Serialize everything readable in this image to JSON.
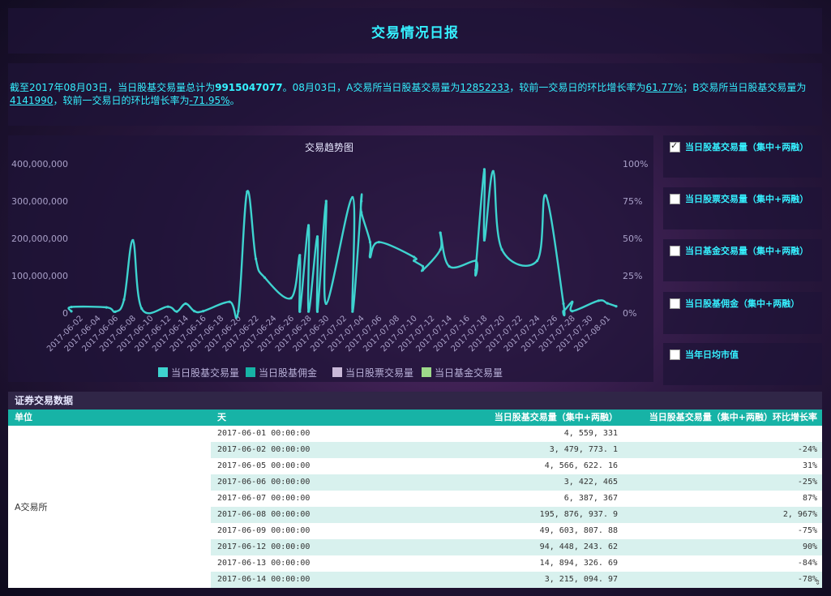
{
  "header": {
    "title": "交易情况日报"
  },
  "summary": {
    "p1": "截至2017年08月03日，当日股基交易量总计为",
    "total": "9915047077",
    "p2": "。08月03日，A交易所当日股基交易量为",
    "a_volume": "12852233",
    "p3": "，较前一交易日的环比增长率为",
    "a_rate": "61.77%",
    "p4": "；B交易所当日股基交易量为",
    "b_volume": "4141990",
    "p5": "，较前一交易日的环比增长率为",
    "b_rate": "-71.95%",
    "p6": "。"
  },
  "chart_data": {
    "type": "line",
    "title": "交易趋势图",
    "ylim": [
      0,
      400000000
    ],
    "y_ticks": [
      "0",
      "100,000,000",
      "200,000,000",
      "300,000,000",
      "400,000,000"
    ],
    "y2lim": [
      0,
      100
    ],
    "y2_ticks": [
      "0%",
      "25%",
      "50%",
      "75%",
      "100%"
    ],
    "x_ticks": [
      "2017-06-02",
      "2017-06-04",
      "2017-06-06",
      "2017-06-08",
      "2017-06-10",
      "2017-06-12",
      "2017-06-14",
      "2017-06-16",
      "2017-06-18",
      "2017-06-20",
      "2017-06-22",
      "2017-06-24",
      "2017-06-26",
      "2017-06-28",
      "2017-06-30",
      "2017-07-02",
      "2017-07-04",
      "2017-07-06",
      "2017-07-08",
      "2017-07-10",
      "2017-07-12",
      "2017-07-14",
      "2017-07-16",
      "2017-07-18",
      "2017-07-20",
      "2017-07-22",
      "2017-07-24",
      "2017-07-26",
      "2017-07-28",
      "2017-07-30",
      "2017-08-01"
    ],
    "grid": false,
    "legend_position": "bottom",
    "series": [
      {
        "name": "当日股基交易量",
        "color": "#3ed3cf",
        "visible": true,
        "x": [
          "2017-06-01",
          "2017-06-01",
          "2017-06-05",
          "2017-06-06",
          "2017-06-07",
          "2017-06-08",
          "2017-06-09",
          "2017-06-12",
          "2017-06-13",
          "2017-06-14",
          "2017-06-15",
          "2017-06-16",
          "2017-06-19",
          "2017-06-20",
          "2017-06-21",
          "2017-06-22",
          "2017-06-23",
          "2017-06-26",
          "2017-06-27",
          "2017-06-27",
          "2017-06-28",
          "2017-06-28",
          "2017-06-29",
          "2017-06-29",
          "2017-06-30",
          "2017-06-30",
          "2017-07-03",
          "2017-07-03",
          "2017-07-04",
          "2017-07-04",
          "2017-07-05",
          "2017-07-05",
          "2017-07-06",
          "2017-07-10",
          "2017-07-10",
          "2017-07-11",
          "2017-07-11",
          "2017-07-13",
          "2017-07-13",
          "2017-07-14",
          "2017-07-17",
          "2017-07-17",
          "2017-07-18",
          "2017-07-18",
          "2017-07-19",
          "2017-07-20",
          "2017-07-24",
          "2017-07-25",
          "2017-07-27",
          "2017-07-27",
          "2017-07-28",
          "2017-07-28",
          "2017-07-31",
          "2017-08-01",
          "2017-08-02"
        ],
        "values": [
          4559331,
          16000000,
          15000000,
          3400000,
          36000000,
          195000000,
          12000000,
          17000000,
          4000000,
          25000000,
          5000000,
          5000000,
          30000000,
          5000000,
          325000000,
          145000000,
          95000000,
          40000000,
          155000000,
          4000000,
          235000000,
          4000000,
          205000000,
          4000000,
          300000000,
          25000000,
          310000000,
          4000000,
          300000000,
          270000000,
          190000000,
          150000000,
          190000000,
          150000000,
          140000000,
          125000000,
          115000000,
          170000000,
          215000000,
          125000000,
          140000000,
          115000000,
          385000000,
          195000000,
          380000000,
          170000000,
          140000000,
          315000000,
          25000000,
          5000000,
          30000000,
          5000000,
          33000000,
          26000000,
          18000000
        ]
      },
      {
        "name": "当日股基佣金",
        "color": "#17b3a6",
        "visible": false
      },
      {
        "name": "当日股票交易量",
        "color": "#c9b8d8",
        "visible": false
      },
      {
        "name": "当日基金交易量",
        "color": "#9ed98a",
        "visible": false
      }
    ]
  },
  "side": {
    "items": [
      {
        "label": "当日股基交易量（集中+两融）",
        "checked": true
      },
      {
        "label": "当日股票交易量（集中+两融）",
        "checked": false
      },
      {
        "label": "当日基金交易量（集中+两融）",
        "checked": false
      },
      {
        "label": "当日股基佣金（集中+两融）",
        "checked": false
      },
      {
        "label": "当年日均市值",
        "checked": false
      }
    ]
  },
  "table": {
    "title": "证券交易数据",
    "headers": {
      "unit": "单位",
      "day": "天",
      "volume": "当日股基交易量（集中+两融）",
      "rate": "当日股基交易量（集中+两融）环比增长率"
    },
    "unit": "A交易所",
    "rows": [
      {
        "day": "2017-06-01 00:00:00",
        "volume": "4, 559, 331",
        "rate": ""
      },
      {
        "day": "2017-06-02 00:00:00",
        "volume": "3, 479, 773. 1",
        "rate": "-24%"
      },
      {
        "day": "2017-06-05 00:00:00",
        "volume": "4, 566, 622. 16",
        "rate": "31%"
      },
      {
        "day": "2017-06-06 00:00:00",
        "volume": "3, 422, 465",
        "rate": "-25%"
      },
      {
        "day": "2017-06-07 00:00:00",
        "volume": "6, 387, 367",
        "rate": "87%"
      },
      {
        "day": "2017-06-08 00:00:00",
        "volume": "195, 876, 937. 9",
        "rate": "2, 967%"
      },
      {
        "day": "2017-06-09 00:00:00",
        "volume": "49, 603, 807. 88",
        "rate": "-75%"
      },
      {
        "day": "2017-06-12 00:00:00",
        "volume": "94, 448, 243. 62",
        "rate": "90%"
      },
      {
        "day": "2017-06-13 00:00:00",
        "volume": "14, 894, 326. 69",
        "rate": "-84%"
      },
      {
        "day": "2017-06-14 00:00:00",
        "volume": "3, 215, 094. 97",
        "rate": "-78%"
      }
    ]
  }
}
